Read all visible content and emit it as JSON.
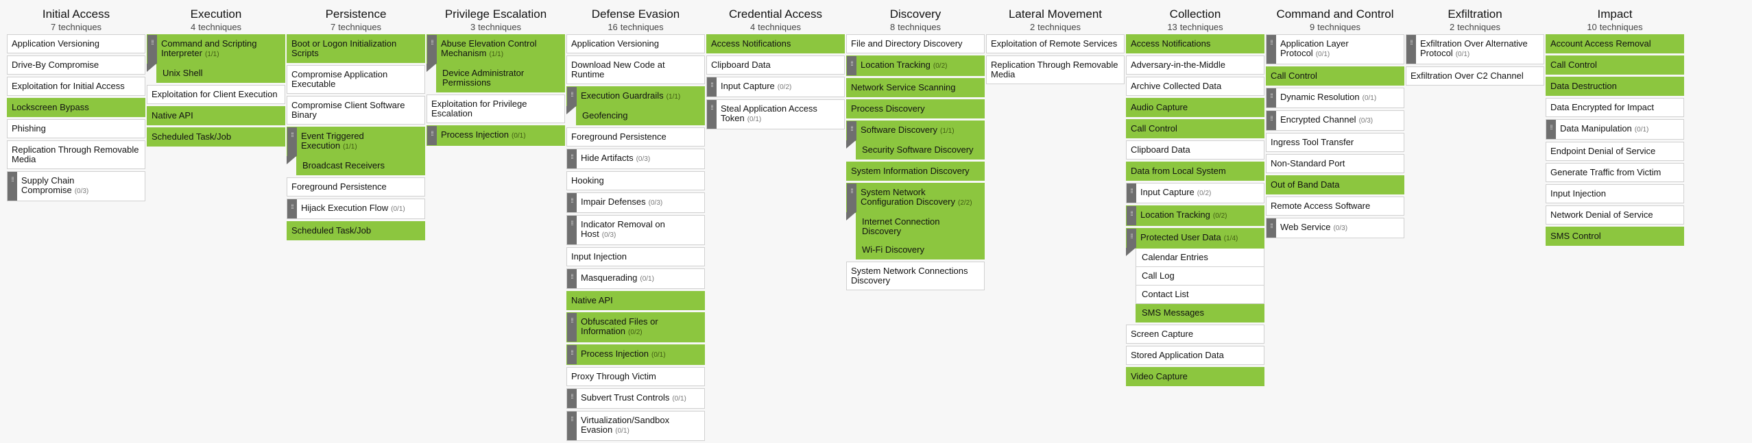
{
  "colors": {
    "highlight": "#8cc63f",
    "handle": "#6f6f6f",
    "border": "#d0d0d0"
  },
  "technique_word": "techniques",
  "tactics": [
    {
      "name": "Initial Access",
      "count": "7",
      "items": [
        {
          "name": "Application Versioning",
          "hl": false
        },
        {
          "name": "Drive-By Compromise",
          "hl": false
        },
        {
          "name": "Exploitation for Initial Access",
          "hl": false
        },
        {
          "name": "Lockscreen Bypass",
          "hl": true
        },
        {
          "name": "Phishing",
          "hl": false
        },
        {
          "name": "Replication Through Removable Media",
          "hl": false
        },
        {
          "name": "Supply Chain Compromise",
          "hl": false,
          "ratio": "(0/3)",
          "handle": true
        }
      ]
    },
    {
      "name": "Execution",
      "count": "4",
      "items": [
        {
          "name": "Command and Scripting Interpreter",
          "hl": true,
          "ratio": "(1/1)",
          "handle": true,
          "subs": [
            {
              "name": "Unix Shell",
              "hl": true
            }
          ]
        },
        {
          "name": "Exploitation for Client Execution",
          "hl": false
        },
        {
          "name": "Native API",
          "hl": true
        },
        {
          "name": "Scheduled Task/Job",
          "hl": true
        }
      ]
    },
    {
      "name": "Persistence",
      "count": "7",
      "items": [
        {
          "name": "Boot or Logon Initialization Scripts",
          "hl": true
        },
        {
          "name": "Compromise Application Executable",
          "hl": false
        },
        {
          "name": "Compromise Client Software Binary",
          "hl": false
        },
        {
          "name": "Event Triggered Execution",
          "hl": true,
          "ratio": "(1/1)",
          "handle": true,
          "subs": [
            {
              "name": "Broadcast Receivers",
              "hl": true
            }
          ]
        },
        {
          "name": "Foreground Persistence",
          "hl": false
        },
        {
          "name": "Hijack Execution Flow",
          "hl": false,
          "ratio": "(0/1)",
          "handle": true
        },
        {
          "name": "Scheduled Task/Job",
          "hl": true
        }
      ]
    },
    {
      "name": "Privilege Escalation",
      "count": "3",
      "items": [
        {
          "name": "Abuse Elevation Control Mechanism",
          "hl": true,
          "ratio": "(1/1)",
          "handle": true,
          "subs": [
            {
              "name": "Device Administrator Permissions",
              "hl": true
            }
          ]
        },
        {
          "name": "Exploitation for Privilege Escalation",
          "hl": false
        },
        {
          "name": "Process Injection",
          "hl": true,
          "ratio": "(0/1)",
          "handle": true
        }
      ]
    },
    {
      "name": "Defense Evasion",
      "count": "16",
      "items": [
        {
          "name": "Application Versioning",
          "hl": false
        },
        {
          "name": "Download New Code at Runtime",
          "hl": false
        },
        {
          "name": "Execution Guardrails",
          "hl": true,
          "ratio": "(1/1)",
          "handle": true,
          "subs": [
            {
              "name": "Geofencing",
              "hl": true
            }
          ]
        },
        {
          "name": "Foreground Persistence",
          "hl": false
        },
        {
          "name": "Hide Artifacts",
          "hl": false,
          "ratio": "(0/3)",
          "handle": true
        },
        {
          "name": "Hooking",
          "hl": false
        },
        {
          "name": "Impair Defenses",
          "hl": false,
          "ratio": "(0/3)",
          "handle": true
        },
        {
          "name": "Indicator Removal on Host",
          "hl": false,
          "ratio": "(0/3)",
          "handle": true
        },
        {
          "name": "Input Injection",
          "hl": false
        },
        {
          "name": "Masquerading",
          "hl": false,
          "ratio": "(0/1)",
          "handle": true
        },
        {
          "name": "Native API",
          "hl": true
        },
        {
          "name": "Obfuscated Files or Information",
          "hl": true,
          "ratio": "(0/2)",
          "handle": true
        },
        {
          "name": "Process Injection",
          "hl": true,
          "ratio": "(0/1)",
          "handle": true
        },
        {
          "name": "Proxy Through Victim",
          "hl": false
        },
        {
          "name": "Subvert Trust Controls",
          "hl": false,
          "ratio": "(0/1)",
          "handle": true
        },
        {
          "name": "Virtualization/Sandbox Evasion",
          "hl": false,
          "ratio": "(0/1)",
          "handle": true
        }
      ]
    },
    {
      "name": "Credential Access",
      "count": "4",
      "items": [
        {
          "name": "Access Notifications",
          "hl": true
        },
        {
          "name": "Clipboard Data",
          "hl": false
        },
        {
          "name": "Input Capture",
          "hl": false,
          "ratio": "(0/2)",
          "handle": true
        },
        {
          "name": "Steal Application Access Token",
          "hl": false,
          "ratio": "(0/1)",
          "handle": true
        }
      ]
    },
    {
      "name": "Discovery",
      "count": "8",
      "items": [
        {
          "name": "File and Directory Discovery",
          "hl": false
        },
        {
          "name": "Location Tracking",
          "hl": true,
          "ratio": "(0/2)",
          "handle": true
        },
        {
          "name": "Network Service Scanning",
          "hl": true
        },
        {
          "name": "Process Discovery",
          "hl": true
        },
        {
          "name": "Software Discovery",
          "hl": true,
          "ratio": "(1/1)",
          "handle": true,
          "subs": [
            {
              "name": "Security Software Discovery",
              "hl": true
            }
          ]
        },
        {
          "name": "System Information Discovery",
          "hl": true
        },
        {
          "name": "System Network Configuration Discovery",
          "hl": true,
          "ratio": "(2/2)",
          "handle": true,
          "subs": [
            {
              "name": "Internet Connection Discovery",
              "hl": true
            },
            {
              "name": "Wi-Fi Discovery",
              "hl": true
            }
          ]
        },
        {
          "name": "System Network Connections Discovery",
          "hl": false
        }
      ]
    },
    {
      "name": "Lateral Movement",
      "count": "2",
      "items": [
        {
          "name": "Exploitation of Remote Services",
          "hl": false
        },
        {
          "name": "Replication Through Removable Media",
          "hl": false
        }
      ]
    },
    {
      "name": "Collection",
      "count": "13",
      "items": [
        {
          "name": "Access Notifications",
          "hl": true
        },
        {
          "name": "Adversary-in-the-Middle",
          "hl": false
        },
        {
          "name": "Archive Collected Data",
          "hl": false
        },
        {
          "name": "Audio Capture",
          "hl": true
        },
        {
          "name": "Call Control",
          "hl": true
        },
        {
          "name": "Clipboard Data",
          "hl": false
        },
        {
          "name": "Data from Local System",
          "hl": true
        },
        {
          "name": "Input Capture",
          "hl": false,
          "ratio": "(0/2)",
          "handle": true
        },
        {
          "name": "Location Tracking",
          "hl": true,
          "ratio": "(0/2)",
          "handle": true
        },
        {
          "name": "Protected User Data",
          "hl": true,
          "ratio": "(1/4)",
          "handle": true,
          "subs": [
            {
              "name": "Calendar Entries",
              "hl": false
            },
            {
              "name": "Call Log",
              "hl": false
            },
            {
              "name": "Contact List",
              "hl": false
            },
            {
              "name": "SMS Messages",
              "hl": true
            }
          ]
        },
        {
          "name": "Screen Capture",
          "hl": false
        },
        {
          "name": "Stored Application Data",
          "hl": false
        },
        {
          "name": "Video Capture",
          "hl": true
        }
      ]
    },
    {
      "name": "Command and Control",
      "count": "9",
      "items": [
        {
          "name": "Application Layer Protocol",
          "hl": false,
          "ratio": "(0/1)",
          "handle": true
        },
        {
          "name": "Call Control",
          "hl": true
        },
        {
          "name": "Dynamic Resolution",
          "hl": false,
          "ratio": "(0/1)",
          "handle": true
        },
        {
          "name": "Encrypted Channel",
          "hl": false,
          "ratio": "(0/3)",
          "handle": true
        },
        {
          "name": "Ingress Tool Transfer",
          "hl": false
        },
        {
          "name": "Non-Standard Port",
          "hl": false
        },
        {
          "name": "Out of Band Data",
          "hl": true
        },
        {
          "name": "Remote Access Software",
          "hl": false
        },
        {
          "name": "Web Service",
          "hl": false,
          "ratio": "(0/3)",
          "handle": true
        }
      ]
    },
    {
      "name": "Exfiltration",
      "count": "2",
      "items": [
        {
          "name": "Exfiltration Over Alternative Protocol",
          "hl": false,
          "ratio": "(0/1)",
          "handle": true
        },
        {
          "name": "Exfiltration Over C2 Channel",
          "hl": false
        }
      ]
    },
    {
      "name": "Impact",
      "count": "10",
      "items": [
        {
          "name": "Account Access Removal",
          "hl": true
        },
        {
          "name": "Call Control",
          "hl": true
        },
        {
          "name": "Data Destruction",
          "hl": true
        },
        {
          "name": "Data Encrypted for Impact",
          "hl": false
        },
        {
          "name": "Data Manipulation",
          "hl": false,
          "ratio": "(0/1)",
          "handle": true
        },
        {
          "name": "Endpoint Denial of Service",
          "hl": false
        },
        {
          "name": "Generate Traffic from Victim",
          "hl": false
        },
        {
          "name": "Input Injection",
          "hl": false
        },
        {
          "name": "Network Denial of Service",
          "hl": false
        },
        {
          "name": "SMS Control",
          "hl": true
        }
      ]
    }
  ]
}
